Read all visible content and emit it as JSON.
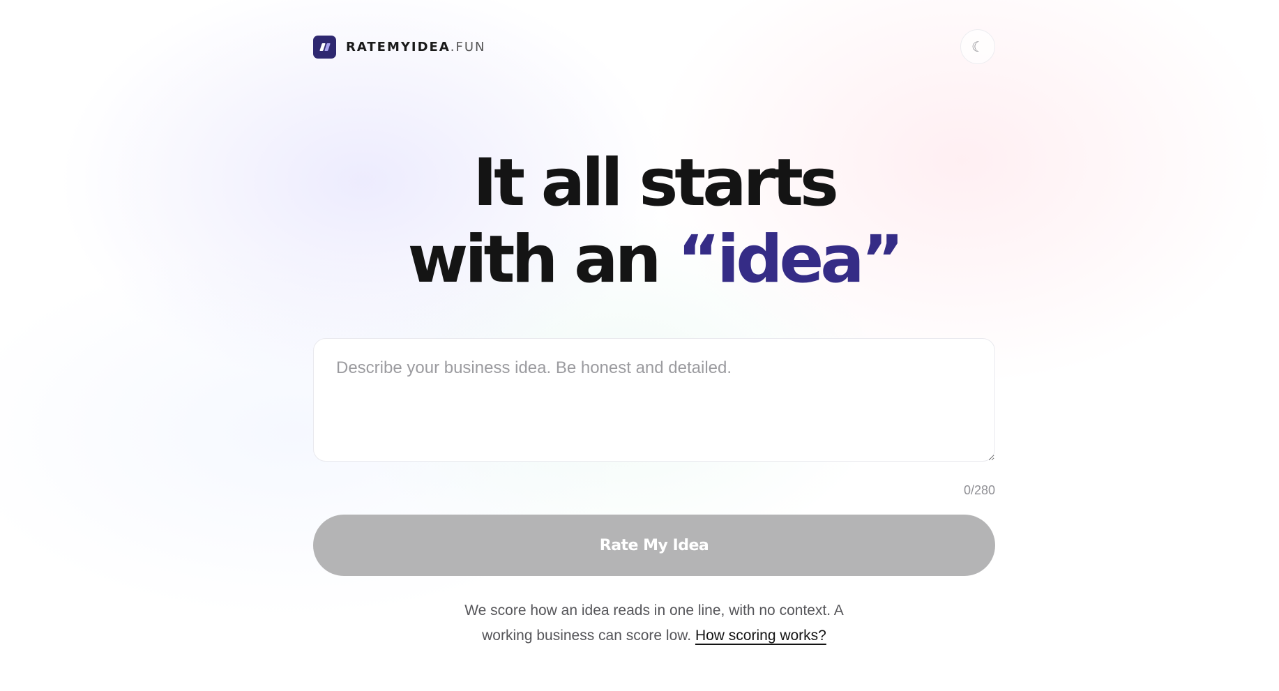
{
  "header": {
    "brand_name": "RATEMYIDEA",
    "brand_tld": ".FUN",
    "theme_toggle_icon": "☾"
  },
  "hero": {
    "line1": "It all starts",
    "line2_prefix": "with an ",
    "line2_accent": "“idea”"
  },
  "form": {
    "idea_placeholder": "Describe your business idea. Be honest and detailed.",
    "idea_value": "",
    "counter": "0/280",
    "submit_label": "Rate My Idea"
  },
  "note": {
    "text": "We score how an idea reads in one line, with no context. A working business can score low. ",
    "link_label": "How scoring works?"
  },
  "colors": {
    "accent": "#352c86",
    "button_disabled": "#b4b4b5"
  }
}
